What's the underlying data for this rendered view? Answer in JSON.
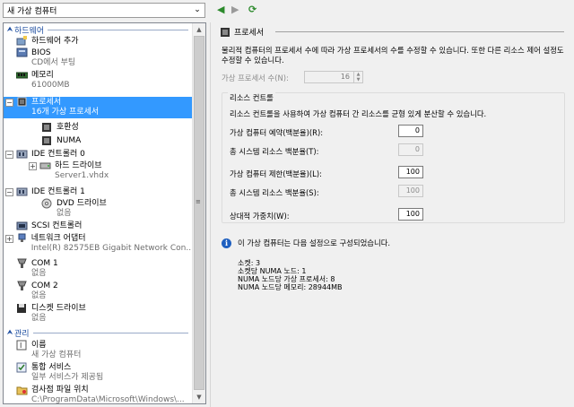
{
  "vm_selector": {
    "value": "새 가상 컴퓨터"
  },
  "tree": {
    "hardware_section": "하드웨어",
    "add_hardware": "하드웨어 추가",
    "bios": {
      "label": "BIOS",
      "sub": "CD에서 부팅"
    },
    "memory": {
      "label": "메모리",
      "sub": "61000MB"
    },
    "processor": {
      "label": "프로세서",
      "sub": "16개 가상 프로세서"
    },
    "compat": "호환성",
    "numa": "NUMA",
    "ide0": "IDE 컨트롤러 0",
    "hdd": {
      "label": "하드 드라이브",
      "sub": "Server1.vhdx"
    },
    "ide1": "IDE 컨트롤러 1",
    "dvd": {
      "label": "DVD 드라이브",
      "sub": "없음"
    },
    "scsi": "SCSI 컨트롤러",
    "nic": {
      "label": "네트워크 어댑터",
      "sub": "Intel(R) 82575EB Gigabit Network Con..."
    },
    "com1": {
      "label": "COM 1",
      "sub": "없음"
    },
    "com2": {
      "label": "COM 2",
      "sub": "없음"
    },
    "floppy": {
      "label": "디스켓 드라이브",
      "sub": "없음"
    },
    "management_section": "관리",
    "name": {
      "label": "이름",
      "sub": "새 가상 컴퓨터"
    },
    "integration": {
      "label": "통합 서비스",
      "sub": "일부 서비스가 제공됨"
    },
    "checkpoint": {
      "label": "검사점 파일 위치",
      "sub": "C:\\ProgramData\\Microsoft\\Windows\\..."
    }
  },
  "panel": {
    "title": "프로세서",
    "description": "물리적 컴퓨터의 프로세서 수에 따라 가상 프로세서의 수를 수정할 수 있습니다. 또한 다른 리소스 제어 설정도 수정할 수 있습니다.",
    "vp_label": "가상 프로세서 수(N):",
    "vp_value": "16",
    "group_title": "리소스 컨트롤",
    "group_desc": "리소스 컨트롤을 사용하여 가상 컴퓨터 간 리소스를 균형 있게 분산할 수 있습니다.",
    "fields": [
      {
        "label": "가상 컴퓨터 예약(백분율)(R):",
        "value": "0"
      },
      {
        "label": "총 시스템 리소스 백분율(T):",
        "value": "0"
      },
      {
        "label": "가상 컴퓨터 제한(백분율)(L):",
        "value": "100"
      },
      {
        "label": "총 시스템 리소스 백분율(S):",
        "value": "100"
      },
      {
        "label": "상대적 가중치(W):",
        "value": "100"
      }
    ],
    "info_text": "이 가상 컴퓨터는 다음 설정으로 구성되었습니다.",
    "config": [
      "소켓: 3",
      "소켓당 NUMA 노드: 1",
      "NUMA 노드당 가상 프로세서: 8",
      "NUMA 노드당 메모리: 28944MB"
    ]
  }
}
